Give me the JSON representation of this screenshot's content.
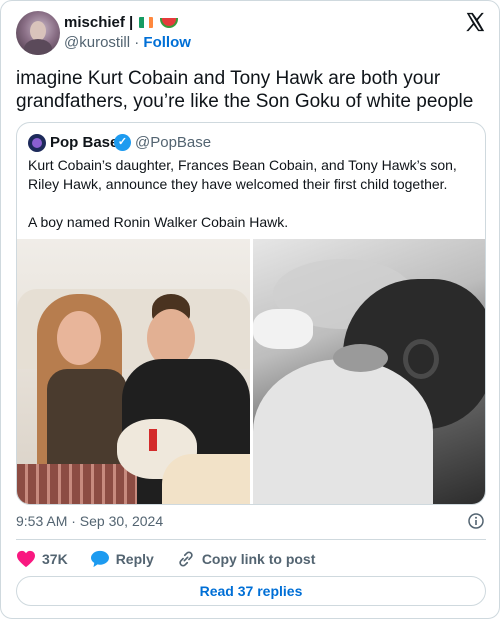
{
  "author": {
    "name": "mischief |",
    "handle": "@kurostill",
    "separator": "·",
    "follow_label": "Follow"
  },
  "tweet_text": "imagine Kurt Cobain and Tony Hawk are both your grandfathers, you’re like the Son Goku of white people",
  "quoted": {
    "name": "Pop Base",
    "verified_mark": "✓",
    "handle": "@PopBase",
    "text": "Kurt Cobain’s daughter, Frances Bean Cobain, and Tony Hawk’s son, Riley Hawk, announce they have welcomed their first child together.\n\nA boy named Ronin Walker Cobain Hawk."
  },
  "timestamp": "9:53 AM · Sep 30, 2024",
  "actions": {
    "likes": "37K",
    "reply_label": "Reply",
    "copy_label": "Copy link to post"
  },
  "read_replies_label": "Read 37 replies",
  "colors": {
    "link": "#006fd6",
    "like": "#f91880",
    "reply": "#1d9bf0",
    "verified": "#1d9bf0",
    "border": "#cfd9de",
    "muted": "#536471"
  },
  "icons": [
    "x-logo-icon",
    "verified-badge-icon",
    "info-icon",
    "heart-icon",
    "reply-bubble-icon",
    "link-icon",
    "ireland-flag-emoji",
    "watermelon-emoji"
  ]
}
